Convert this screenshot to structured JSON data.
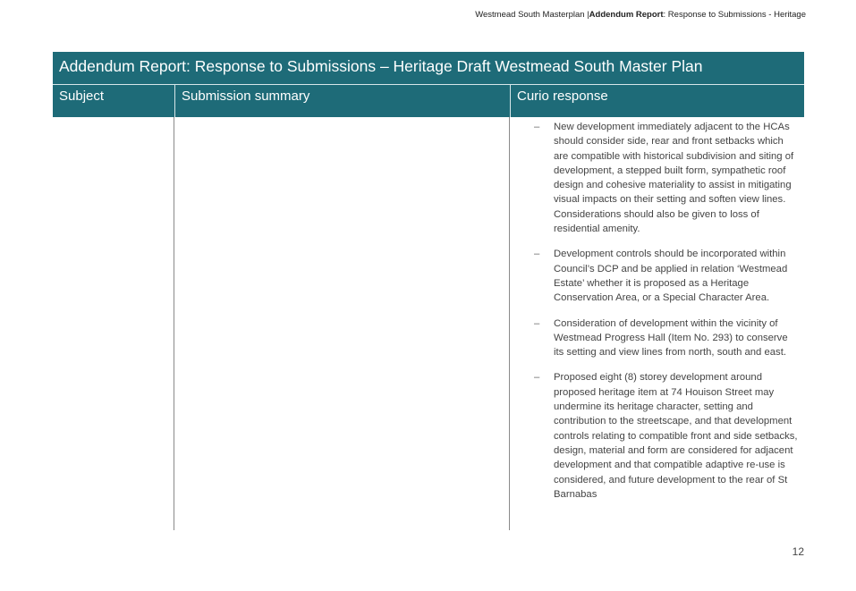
{
  "running_header": {
    "prefix": "Westmead South Masterplan |",
    "bold": "Addendum Report",
    "suffix": ": Response to Submissions - Heritage"
  },
  "table": {
    "title": "Addendum Report: Response to Submissions – Heritage Draft Westmead South Master Plan",
    "headers": {
      "subject": "Subject",
      "summary": "Submission summary",
      "response": "Curio response"
    },
    "bullet_symbol": "–",
    "responses": [
      "New development immediately adjacent to the HCAs should consider side, rear and front setbacks which are compatible with historical subdivision and siting of development, a stepped built form, sympathetic roof design and cohesive materiality to assist in mitigating visual impacts on their setting and soften view lines. Considerations should also be given to loss of residential amenity.",
      "Development controls should be incorporated within Council’s DCP and be applied in relation ‘Westmead Estate’ whether it is proposed as a Heritage Conservation Area, or a Special Character Area.",
      "Consideration of development within the vicinity of Westmead Progress Hall (Item No. 293) to conserve its setting and view lines from north, south and east.",
      "Proposed eight (8) storey development around proposed heritage item at 74 Houison Street may undermine its heritage character, setting and contribution to the streetscape, and that development controls relating to compatible front and side setbacks, design, material and form are considered for adjacent development and that compatible adaptive re-use is considered, and future development to the rear of St Barnabas"
    ]
  },
  "page_number": "12"
}
